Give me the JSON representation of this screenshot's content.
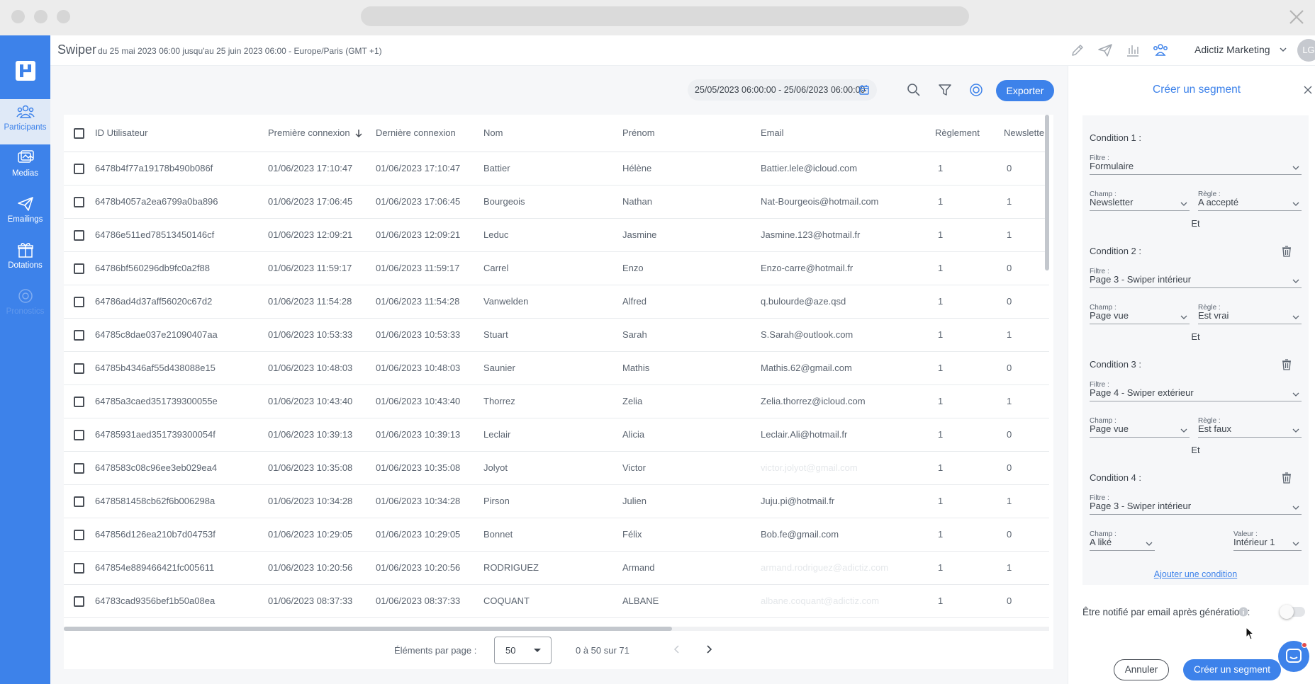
{
  "header": {
    "app_name": "Swiper",
    "date_range_text": "du 25 mai 2023 06:00 jusqu'au 25 juin 2023 06:00 - Europe/Paris (GMT +1)",
    "org_name": "Adictiz Marketing",
    "avatar_initials": "LG"
  },
  "sidebar": {
    "items": [
      {
        "label": "Participants",
        "icon": "participants-icon"
      },
      {
        "label": "Medias",
        "icon": "medias-icon"
      },
      {
        "label": "Emailings",
        "icon": "send-icon"
      },
      {
        "label": "Dotations",
        "icon": "gift-icon"
      },
      {
        "label": "Pronostics",
        "icon": "target-icon"
      }
    ]
  },
  "toolbar": {
    "date_range": "25/05/2023 06:00:00 - 25/06/2023 06:00:00",
    "export_label": "Exporter"
  },
  "table": {
    "columns": [
      "ID Utilisateur",
      "Première connexion",
      "Dernière connexion",
      "Nom",
      "Prénom",
      "Email",
      "Règlement",
      "Newsletter"
    ],
    "rows": [
      [
        "6478b4f77a19178b490b086f",
        "01/06/2023 17:10:47",
        "01/06/2023 17:10:47",
        "Battier",
        "Hélène",
        "Battier.lele@icloud.com",
        "1",
        "0"
      ],
      [
        "6478b4057a2ea6799a0ba896",
        "01/06/2023 17:06:45",
        "01/06/2023 17:06:45",
        "Bourgeois",
        "Nathan",
        "Nat-Bourgeois@hotmail.com",
        "1",
        "1"
      ],
      [
        "64786e511ed78513450146cf",
        "01/06/2023 12:09:21",
        "01/06/2023 12:09:21",
        "Leduc",
        "Jasmine",
        "Jasmine.123@hotmail.fr",
        "1",
        "1"
      ],
      [
        "64786bf560296db9fc0a2f88",
        "01/06/2023 11:59:17",
        "01/06/2023 11:59:17",
        "Carrel",
        "Enzo",
        "Enzo-carre@hotmail.fr",
        "1",
        "0"
      ],
      [
        "64786ad4d37aff56020c67d2",
        "01/06/2023 11:54:28",
        "01/06/2023 11:54:28",
        "Vanwelden",
        "Alfred",
        "q.bulourde@aze.qsd",
        "1",
        "0"
      ],
      [
        "64785c8dae037e21090407aa",
        "01/06/2023 10:53:33",
        "01/06/2023 10:53:33",
        "Stuart",
        "Sarah",
        "S.Sarah@outlook.com",
        "1",
        "1"
      ],
      [
        "64785b4346af55d438088e15",
        "01/06/2023 10:48:03",
        "01/06/2023 10:48:03",
        "Saunier",
        "Mathis",
        "Mathis.62@gmail.com",
        "1",
        "0"
      ],
      [
        "64785a3caed351739300055e",
        "01/06/2023 10:43:40",
        "01/06/2023 10:43:40",
        "Thorrez",
        "Zelia",
        "Zelia.thorrez@icloud.com",
        "1",
        "1"
      ],
      [
        "64785931aed351739300054f",
        "01/06/2023 10:39:13",
        "01/06/2023 10:39:13",
        "Leclair",
        "Alicia",
        "Leclair.Ali@hotmail.fr",
        "1",
        "0"
      ],
      [
        "6478583c08c96ee3eb029ea4",
        "01/06/2023 10:35:08",
        "01/06/2023 10:35:08",
        "Jolyot",
        "Victor",
        "victor.jolyot@gmail.com",
        "1",
        "0"
      ],
      [
        "6478581458cb62f6b006298a",
        "01/06/2023 10:34:28",
        "01/06/2023 10:34:28",
        "Pirson",
        "Julien",
        "Juju.pi@hotmail.fr",
        "1",
        "1"
      ],
      [
        "647856d126ea210b7d04753f",
        "01/06/2023 10:29:05",
        "01/06/2023 10:29:05",
        "Bonnet",
        "Félix",
        "Bob.fe@gmail.com",
        "1",
        "0"
      ],
      [
        "647854e889466421fc005611",
        "01/06/2023 10:20:56",
        "01/06/2023 10:20:56",
        "RODRIGUEZ",
        "Armand",
        "armand.rodriguez@adictiz.com",
        "1",
        "1"
      ],
      [
        "64783cad9356bef1b50a08ea",
        "01/06/2023 08:37:33",
        "01/06/2023 08:37:33",
        "COQUANT",
        "ALBANE",
        "albane.coquant@adictiz.com",
        "1",
        "0"
      ]
    ],
    "faded_email_rows": [
      9,
      12,
      13
    ]
  },
  "pagination": {
    "per_page_label": "Éléments par page :",
    "per_page_value": "50",
    "range_text": "0 à 50 sur 71"
  },
  "panel": {
    "title": "Créer un segment",
    "filter_label": "Filtre :",
    "field_label": "Champ :",
    "rule_label": "Règle :",
    "value_label": "Valeur :",
    "and_label": "Et",
    "conditions": [
      {
        "title": "Condition 1 :",
        "filter": "Formulaire",
        "field": "Newsletter",
        "rule": "A accepté"
      },
      {
        "title": "Condition 2 :",
        "filter": "Page 3 - Swiper intérieur",
        "field": "Page vue",
        "rule": "Est vrai"
      },
      {
        "title": "Condition 3 :",
        "filter": "Page 4 - Swiper extérieur",
        "field": "Page vue",
        "rule": "Est faux"
      },
      {
        "title": "Condition 4 :",
        "filter": "Page 3 - Swiper intérieur",
        "field": "A liké",
        "value": "Intérieur 1"
      }
    ],
    "add_condition": "Ajouter une condition",
    "notify_label": "Être notifié par email après génération :",
    "notify_enabled": false,
    "cancel_label": "Annuler",
    "create_label": "Créer un segment"
  },
  "colors": {
    "primary": "#3d82ea",
    "sidebar_active_bg": "#dfe9f7",
    "panel_box_bg": "#f6f7f9"
  }
}
